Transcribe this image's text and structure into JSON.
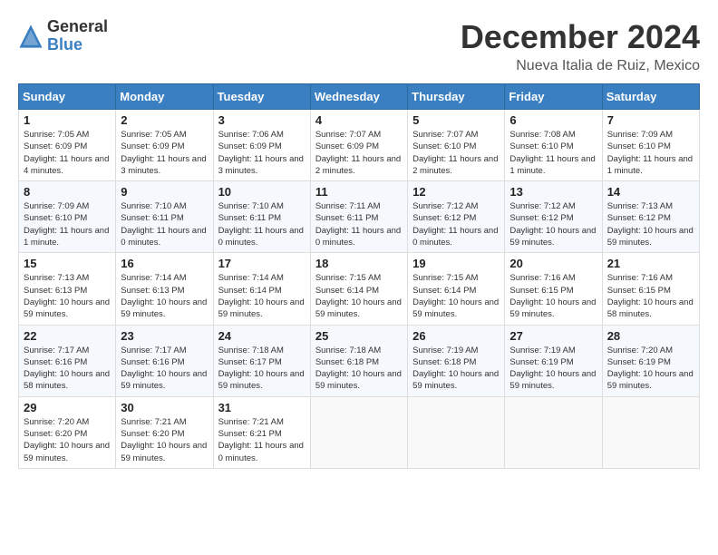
{
  "logo": {
    "general": "General",
    "blue": "Blue"
  },
  "title": {
    "month": "December 2024",
    "location": "Nueva Italia de Ruiz, Mexico"
  },
  "weekdays": [
    "Sunday",
    "Monday",
    "Tuesday",
    "Wednesday",
    "Thursday",
    "Friday",
    "Saturday"
  ],
  "weeks": [
    [
      {
        "day": "1",
        "sunrise": "7:05 AM",
        "sunset": "6:09 PM",
        "daylight": "11 hours and 4 minutes."
      },
      {
        "day": "2",
        "sunrise": "7:05 AM",
        "sunset": "6:09 PM",
        "daylight": "11 hours and 3 minutes."
      },
      {
        "day": "3",
        "sunrise": "7:06 AM",
        "sunset": "6:09 PM",
        "daylight": "11 hours and 3 minutes."
      },
      {
        "day": "4",
        "sunrise": "7:07 AM",
        "sunset": "6:09 PM",
        "daylight": "11 hours and 2 minutes."
      },
      {
        "day": "5",
        "sunrise": "7:07 AM",
        "sunset": "6:10 PM",
        "daylight": "11 hours and 2 minutes."
      },
      {
        "day": "6",
        "sunrise": "7:08 AM",
        "sunset": "6:10 PM",
        "daylight": "11 hours and 1 minute."
      },
      {
        "day": "7",
        "sunrise": "7:09 AM",
        "sunset": "6:10 PM",
        "daylight": "11 hours and 1 minute."
      }
    ],
    [
      {
        "day": "8",
        "sunrise": "7:09 AM",
        "sunset": "6:10 PM",
        "daylight": "11 hours and 1 minute."
      },
      {
        "day": "9",
        "sunrise": "7:10 AM",
        "sunset": "6:11 PM",
        "daylight": "11 hours and 0 minutes."
      },
      {
        "day": "10",
        "sunrise": "7:10 AM",
        "sunset": "6:11 PM",
        "daylight": "11 hours and 0 minutes."
      },
      {
        "day": "11",
        "sunrise": "7:11 AM",
        "sunset": "6:11 PM",
        "daylight": "11 hours and 0 minutes."
      },
      {
        "day": "12",
        "sunrise": "7:12 AM",
        "sunset": "6:12 PM",
        "daylight": "11 hours and 0 minutes."
      },
      {
        "day": "13",
        "sunrise": "7:12 AM",
        "sunset": "6:12 PM",
        "daylight": "10 hours and 59 minutes."
      },
      {
        "day": "14",
        "sunrise": "7:13 AM",
        "sunset": "6:12 PM",
        "daylight": "10 hours and 59 minutes."
      }
    ],
    [
      {
        "day": "15",
        "sunrise": "7:13 AM",
        "sunset": "6:13 PM",
        "daylight": "10 hours and 59 minutes."
      },
      {
        "day": "16",
        "sunrise": "7:14 AM",
        "sunset": "6:13 PM",
        "daylight": "10 hours and 59 minutes."
      },
      {
        "day": "17",
        "sunrise": "7:14 AM",
        "sunset": "6:14 PM",
        "daylight": "10 hours and 59 minutes."
      },
      {
        "day": "18",
        "sunrise": "7:15 AM",
        "sunset": "6:14 PM",
        "daylight": "10 hours and 59 minutes."
      },
      {
        "day": "19",
        "sunrise": "7:15 AM",
        "sunset": "6:14 PM",
        "daylight": "10 hours and 59 minutes."
      },
      {
        "day": "20",
        "sunrise": "7:16 AM",
        "sunset": "6:15 PM",
        "daylight": "10 hours and 59 minutes."
      },
      {
        "day": "21",
        "sunrise": "7:16 AM",
        "sunset": "6:15 PM",
        "daylight": "10 hours and 58 minutes."
      }
    ],
    [
      {
        "day": "22",
        "sunrise": "7:17 AM",
        "sunset": "6:16 PM",
        "daylight": "10 hours and 58 minutes."
      },
      {
        "day": "23",
        "sunrise": "7:17 AM",
        "sunset": "6:16 PM",
        "daylight": "10 hours and 59 minutes."
      },
      {
        "day": "24",
        "sunrise": "7:18 AM",
        "sunset": "6:17 PM",
        "daylight": "10 hours and 59 minutes."
      },
      {
        "day": "25",
        "sunrise": "7:18 AM",
        "sunset": "6:18 PM",
        "daylight": "10 hours and 59 minutes."
      },
      {
        "day": "26",
        "sunrise": "7:19 AM",
        "sunset": "6:18 PM",
        "daylight": "10 hours and 59 minutes."
      },
      {
        "day": "27",
        "sunrise": "7:19 AM",
        "sunset": "6:19 PM",
        "daylight": "10 hours and 59 minutes."
      },
      {
        "day": "28",
        "sunrise": "7:20 AM",
        "sunset": "6:19 PM",
        "daylight": "10 hours and 59 minutes."
      }
    ],
    [
      {
        "day": "29",
        "sunrise": "7:20 AM",
        "sunset": "6:20 PM",
        "daylight": "10 hours and 59 minutes."
      },
      {
        "day": "30",
        "sunrise": "7:21 AM",
        "sunset": "6:20 PM",
        "daylight": "10 hours and 59 minutes."
      },
      {
        "day": "31",
        "sunrise": "7:21 AM",
        "sunset": "6:21 PM",
        "daylight": "11 hours and 0 minutes."
      },
      null,
      null,
      null,
      null
    ]
  ]
}
